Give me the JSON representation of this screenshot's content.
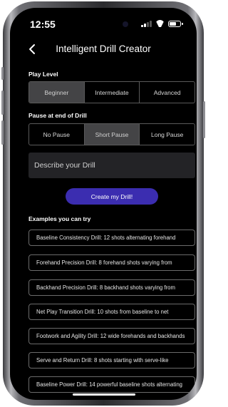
{
  "status_bar": {
    "time": "12:55"
  },
  "nav": {
    "title": "Intelligent Drill Creator",
    "back_icon": "chevron-left-icon"
  },
  "play_level": {
    "label": "Play Level",
    "options": [
      "Beginner",
      "Intermediate",
      "Advanced"
    ],
    "selected": "Beginner"
  },
  "pause": {
    "label": "Pause at end of Drill",
    "options": [
      "No Pause",
      "Short Pause",
      "Long Pause"
    ],
    "selected": "Short Pause"
  },
  "describe": {
    "placeholder": "Describe your Drill",
    "value": ""
  },
  "create_button": {
    "label": "Create my Drill!"
  },
  "examples": {
    "label": "Examples you can try",
    "items": [
      "Baseline Consistency Drill: 12 shots alternating forehand",
      "Forehand Precision Drill: 8 forehand shots varying from",
      "Backhand Precision Drill: 8 backhand shots varying from",
      "Net Play Transition Drill: 10 shots from baseline to net",
      "Footwork and Agility Drill: 12 wide forehands and backhands",
      "Serve and Return Drill: 8 shots starting with serve-like",
      "Baseline Power Drill: 14 powerful baseline shots alternating"
    ]
  },
  "colors": {
    "screen_bg": "#000000",
    "accent": "#3b2db0",
    "segment_active": "#444446",
    "field_bg": "#232326"
  }
}
